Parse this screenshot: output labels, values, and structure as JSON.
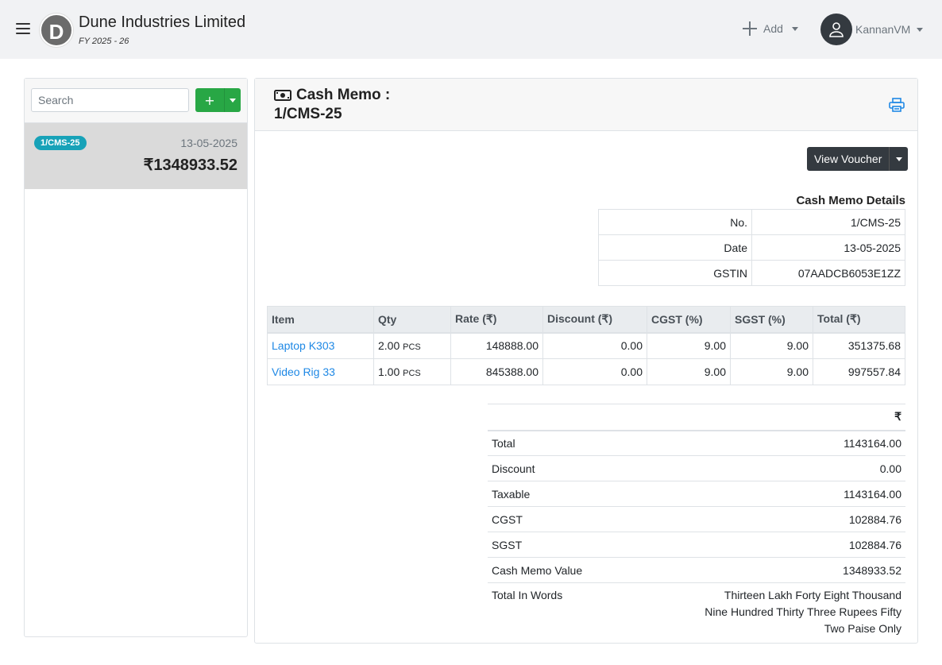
{
  "header": {
    "company_initial": "D",
    "company_name": "Dune Industries Limited",
    "fiscal_year": "FY 2025 - 26",
    "add_label": "Add",
    "user_name": "KannanVM"
  },
  "sidebar": {
    "search_placeholder": "Search",
    "add_button_label": "+",
    "items": [
      {
        "number": "1/CMS-25",
        "date": "13-05-2025",
        "amount": "₹1348933.52"
      }
    ]
  },
  "document": {
    "title": "Cash Memo :",
    "number": "1/CMS-25",
    "view_voucher_label": "View Voucher",
    "details_title": "Cash Memo Details",
    "details": [
      {
        "label": "No.",
        "value": "1/CMS-25"
      },
      {
        "label": "Date",
        "value": "13-05-2025"
      },
      {
        "label": "GSTIN",
        "value": "07AADCB6053E1ZZ"
      }
    ],
    "item_columns": [
      "Item",
      "Qty",
      "Rate (₹)",
      "Discount (₹)",
      "CGST (%)",
      "SGST (%)",
      "Total (₹)"
    ],
    "items": [
      {
        "name": "Laptop K303",
        "qty": "2.00",
        "unit": "PCS",
        "rate": "148888.00",
        "discount": "0.00",
        "cgst": "9.00",
        "sgst": "9.00",
        "total": "351375.68"
      },
      {
        "name": "Video Rig 33",
        "qty": "1.00",
        "unit": "PCS",
        "rate": "845388.00",
        "discount": "0.00",
        "cgst": "9.00",
        "sgst": "9.00",
        "total": "997557.84"
      }
    ],
    "summary_currency": "₹",
    "summary": [
      {
        "label": "Total",
        "value": "1143164.00"
      },
      {
        "label": "Discount",
        "value": "0.00"
      },
      {
        "label": "Taxable",
        "value": "1143164.00"
      },
      {
        "label": "CGST",
        "value": "102884.76"
      },
      {
        "label": "SGST",
        "value": "102884.76"
      },
      {
        "label": "Cash Memo Value",
        "value": "1348933.52"
      }
    ],
    "words_label": "Total In Words",
    "words_lines": [
      "Thirteen Lakh Forty Eight Thousand",
      "Nine Hundred Thirty Three Rupees Fifty",
      "Two Paise Only"
    ]
  },
  "colors": {
    "accent_green": "#28a745",
    "badge_teal": "#17a2b8",
    "link_blue": "#1e88e5",
    "dark_button": "#343a40"
  }
}
